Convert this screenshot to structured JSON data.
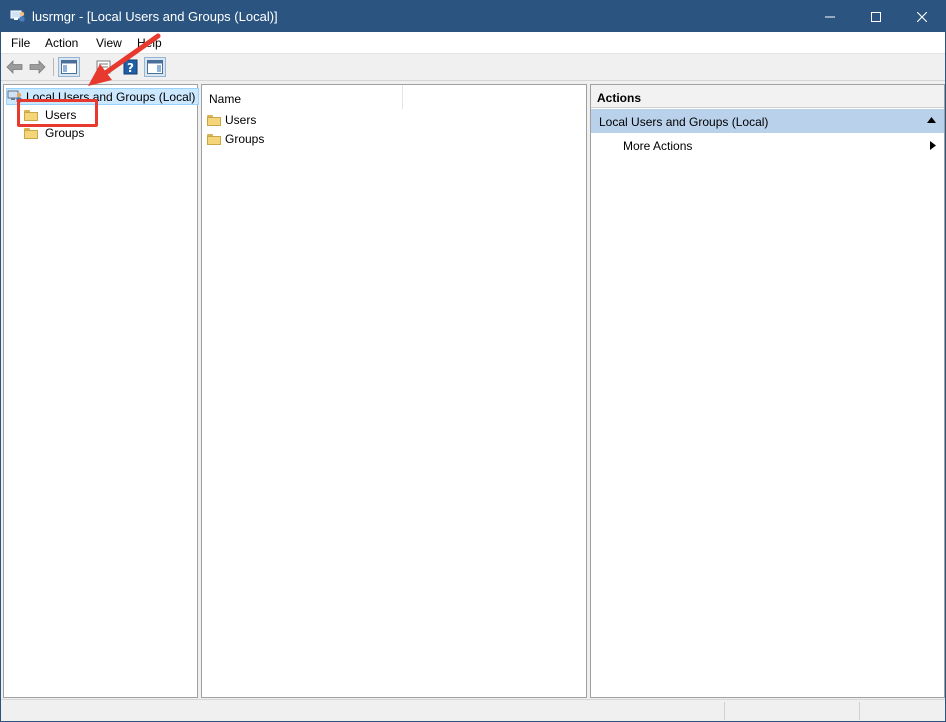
{
  "window": {
    "title": "lusrmgr - [Local Users and Groups (Local)]",
    "app_icon": "snapin-computer-icon",
    "controls": [
      "minimize-icon",
      "maximize-icon",
      "close-icon"
    ]
  },
  "menu": {
    "items": [
      {
        "label": "File"
      },
      {
        "label": "Action"
      },
      {
        "label": "View"
      },
      {
        "label": "Help"
      }
    ]
  },
  "toolbar": {
    "buttons": [
      "back-arrow-icon",
      "forward-arrow-icon",
      "show-hide-console-tree-icon",
      "properties-icon",
      "help-icon",
      "show-hide-action-pane-icon"
    ]
  },
  "tree": {
    "root_label": "Local Users and Groups (Local)",
    "children": [
      {
        "label": "Users"
      },
      {
        "label": "Groups"
      }
    ]
  },
  "list": {
    "column_name": "Name",
    "items": [
      {
        "label": "Users"
      },
      {
        "label": "Groups"
      }
    ]
  },
  "actions": {
    "title": "Actions",
    "section_title": "Local Users and Groups (Local)",
    "items": [
      {
        "label": "More Actions"
      }
    ]
  },
  "annotation": {
    "highlight_color": "#e8392f"
  },
  "colors": {
    "titlebar": "#2b5580",
    "selection": "#cce8ff",
    "actions_section": "#b9d1ea"
  }
}
